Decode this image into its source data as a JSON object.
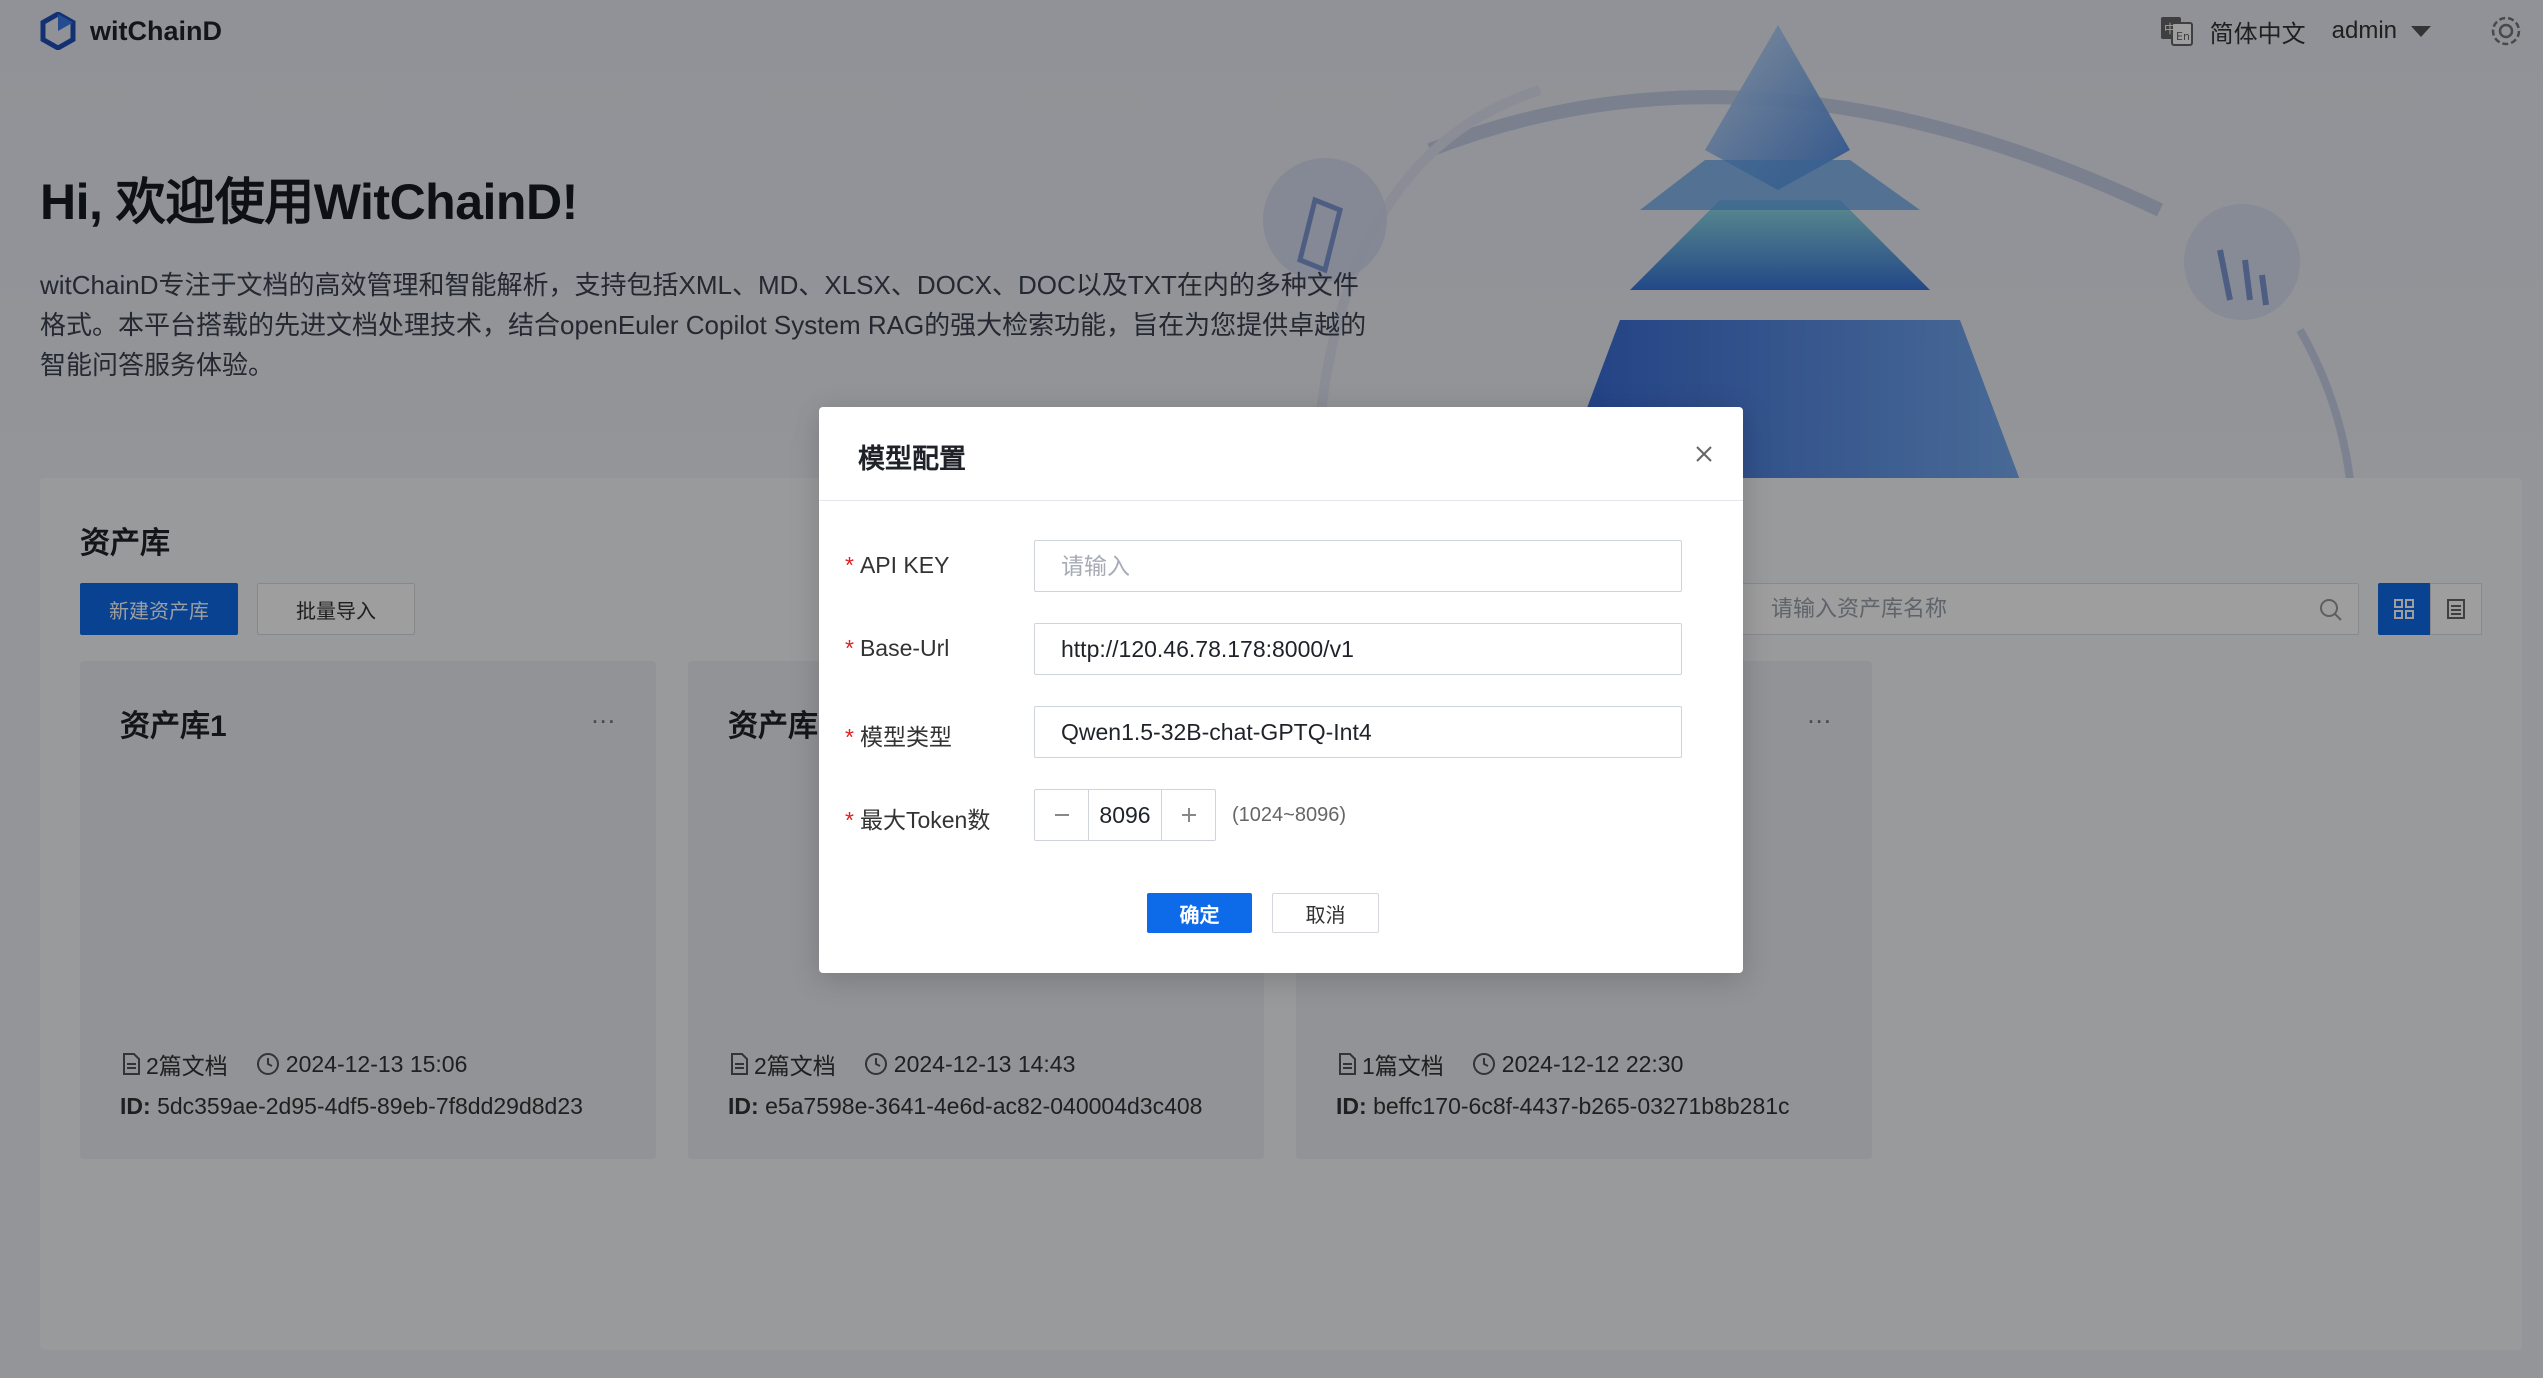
{
  "app": {
    "name": "witChainD",
    "language": "简体中文",
    "user": "admin"
  },
  "hero": {
    "title": "Hi, 欢迎使用WitChainD!",
    "description": "witChainD专注于文档的高效管理和智能解析，支持包括XML、MD、XLSX、DOCX、DOC以及TXT在内的多种文件格式。本平台搭载的先进文档处理技术，结合openEuler Copilot System RAG的强大检索功能，旨在为您提供卓越的智能问答服务体验。"
  },
  "assets": {
    "title": "资产库",
    "new_button": "新建资产库",
    "import_button": "批量导入",
    "search_placeholder": "请输入资产库名称",
    "cards": [
      {
        "title": "资产库1",
        "more": "...",
        "docs": "2篇文档",
        "time": "2024-12-13 15:06",
        "id_label": "ID:",
        "id": "5dc359ae-2d95-4df5-89eb-7f8dd29d8d23"
      },
      {
        "title": "资产库2",
        "more": "...",
        "docs": "2篇文档",
        "time": "2024-12-13 14:43",
        "id_label": "ID:",
        "id": "e5a7598e-3641-4e6d-ac82-040004d3c408"
      },
      {
        "title": "",
        "more": "...",
        "docs": "1篇文档",
        "time": "2024-12-12 22:30",
        "id_label": "ID:",
        "id": "beffc170-6c8f-4437-b265-03271b8b281c"
      }
    ]
  },
  "dialog": {
    "title": "模型配置",
    "required_mark": "*",
    "fields": {
      "api_key": {
        "label": "API KEY",
        "value": "",
        "placeholder": "请输入"
      },
      "base_url": {
        "label": "Base-Url",
        "value": "http://120.46.78.178:8000/v1"
      },
      "model_type": {
        "label": "模型类型",
        "value": "Qwen1.5-32B-chat-GPTQ-Int4"
      },
      "max_token": {
        "label": "最大Token数",
        "value": "8096",
        "range": "(1024~8096)"
      }
    },
    "ok": "确定",
    "cancel": "取消"
  },
  "colors": {
    "primary": "#0d6bea",
    "required": "#e02020",
    "mask": "rgba(0,0,0,0.38)"
  }
}
